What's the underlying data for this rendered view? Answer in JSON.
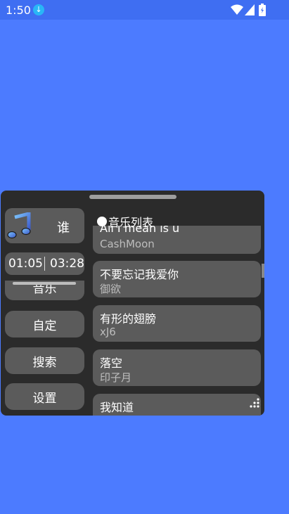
{
  "status": {
    "time": "1:50",
    "icons": [
      "download-icon",
      "wifi-icon",
      "signal-icon",
      "battery-icon"
    ]
  },
  "player": {
    "song_name": "谁",
    "current_time": "01:05",
    "total_time": "03:28"
  },
  "side_menu": {
    "items": [
      {
        "label": "音乐"
      },
      {
        "label": "自定"
      },
      {
        "label": "搜索"
      },
      {
        "label": "设置"
      }
    ]
  },
  "playlist": {
    "header": "音乐列表",
    "songs": [
      {
        "title": "All I mean is u",
        "artist": "CashMoon"
      },
      {
        "title": "不要忘记我爱你",
        "artist": "御欲"
      },
      {
        "title": "有形的翅膀",
        "artist": "xJ6"
      },
      {
        "title": "落空",
        "artist": "印子月"
      },
      {
        "title": "我知道",
        "artist": ""
      }
    ]
  },
  "colors": {
    "background": "#4c7bff",
    "panel": "#2b2b2b",
    "card": "#5b5b5b"
  }
}
